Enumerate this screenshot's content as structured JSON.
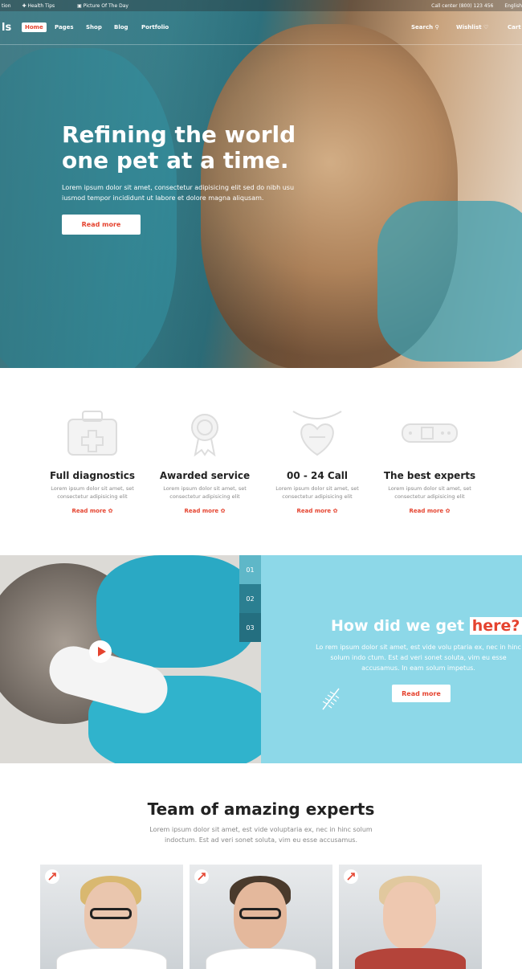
{
  "topbar": {
    "left": [
      "tion",
      "Health Tips",
      "Picture Of The Day"
    ],
    "call": "Call center (800) 123 456",
    "lang": "English"
  },
  "nav": {
    "logo": "ls",
    "items": [
      "Home",
      "Pages",
      "Shop",
      "Blog",
      "Portfolio"
    ],
    "search": "Search",
    "wishlist": "Wishlist",
    "cart": "Cart"
  },
  "hero": {
    "title": "Refining the world one pet at a time.",
    "text": "Lorem ipsum dolor sit amet, consectetur adipisicing elit sed do nibh usu iusmod tempor incididunt ut labore et dolore magna aliqusam.",
    "button": "Read more"
  },
  "services": [
    {
      "title": "Full diagnostics",
      "text": "Lorem ipsum dolor sit amet, set consectetur adipisicing elit",
      "more": "Read more",
      "icon": "first-aid-kit-icon"
    },
    {
      "title": "Awarded service",
      "text": "Lorem ipsum dolor sit amet, set consectetur adipisicing elit",
      "more": "Read more",
      "icon": "award-ribbon-icon"
    },
    {
      "title": "00 - 24 Call",
      "text": "Lorem ipsum dolor sit amet, set consectetur adipisicing elit",
      "more": "Read more",
      "icon": "pet-tag-heart-icon"
    },
    {
      "title": "The best experts",
      "text": "Lorem ipsum dolor sit amet, set consectetur adipisicing elit",
      "more": "Read more",
      "icon": "pet-collar-icon"
    }
  ],
  "how": {
    "tabs": [
      "01",
      "02",
      "03"
    ],
    "title": "How did we get",
    "highlight": "here?",
    "text": "Lo rem ipsum dolor sit amet, est vide volu ptaria ex, nec in hinc solum indo ctum. Est ad veri sonet soluta, vim eu esse accusamus. In eam solum impetus.",
    "button": "Read more"
  },
  "team": {
    "title": "Team of amazing experts",
    "text": "Lorem ipsum dolor sit amet, est vide voluptaria ex, nec in hinc solum indoctum. Est ad veri sonet soluta, vim eu esse accusamus."
  },
  "colors": {
    "accent": "#e5432f",
    "teal": "#8dd8e8",
    "darkTab": "#2b7f91"
  }
}
